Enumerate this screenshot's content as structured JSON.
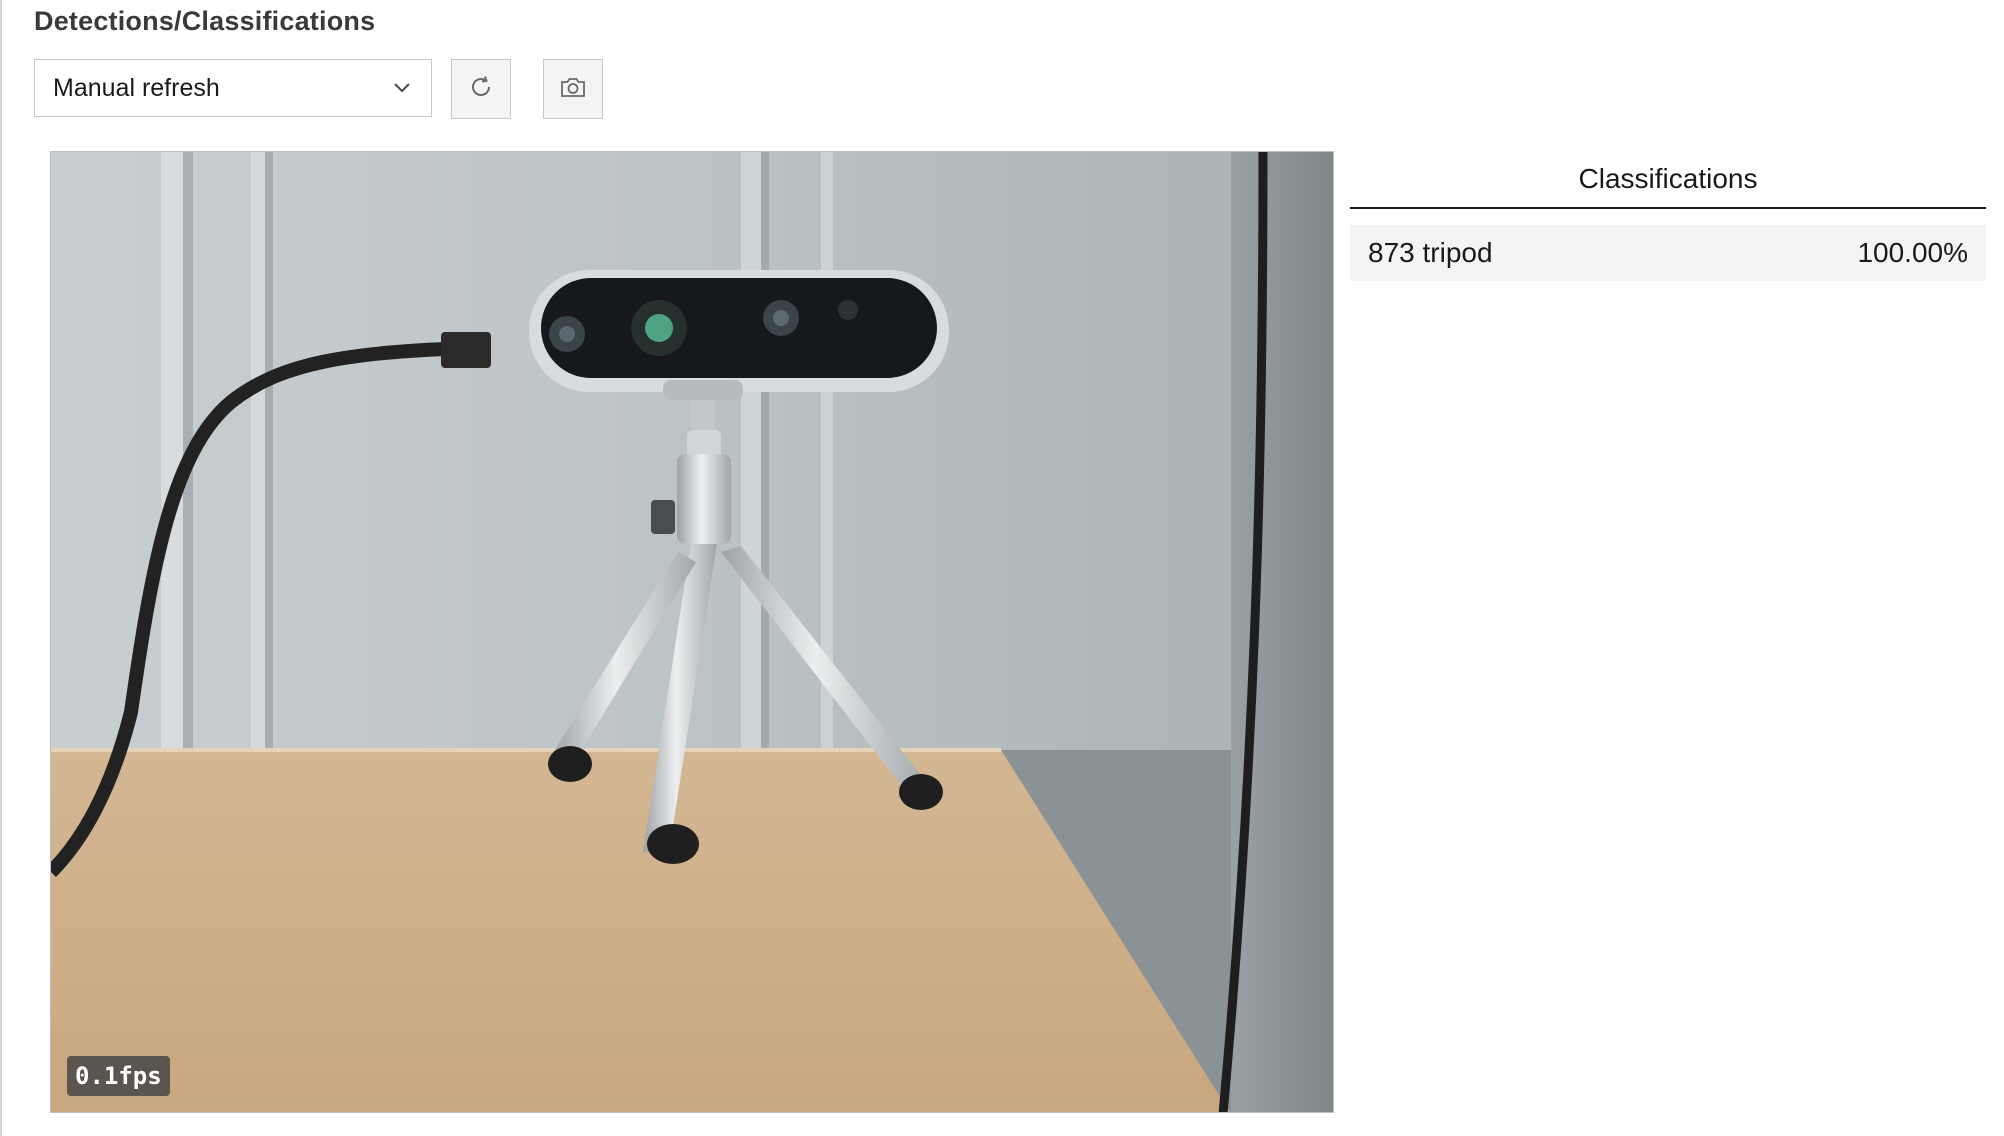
{
  "page": {
    "title": "Detections/Classifications"
  },
  "toolbar": {
    "refresh_mode": "Manual refresh",
    "refresh_icon": "refresh-icon",
    "snapshot_icon": "camera-icon",
    "chevron_icon": "chevron-down-icon"
  },
  "camera": {
    "fps": "0.1fps"
  },
  "classifications": {
    "header": "Classifications",
    "items": [
      {
        "label": "873 tripod",
        "score": "100.00%"
      }
    ]
  },
  "colors": {
    "border": "#c8c8c8",
    "button_bg": "#f4f4f4",
    "row_bg": "#f4f4f4",
    "text": "#1a1a1a",
    "fps_bg": "#464646"
  }
}
